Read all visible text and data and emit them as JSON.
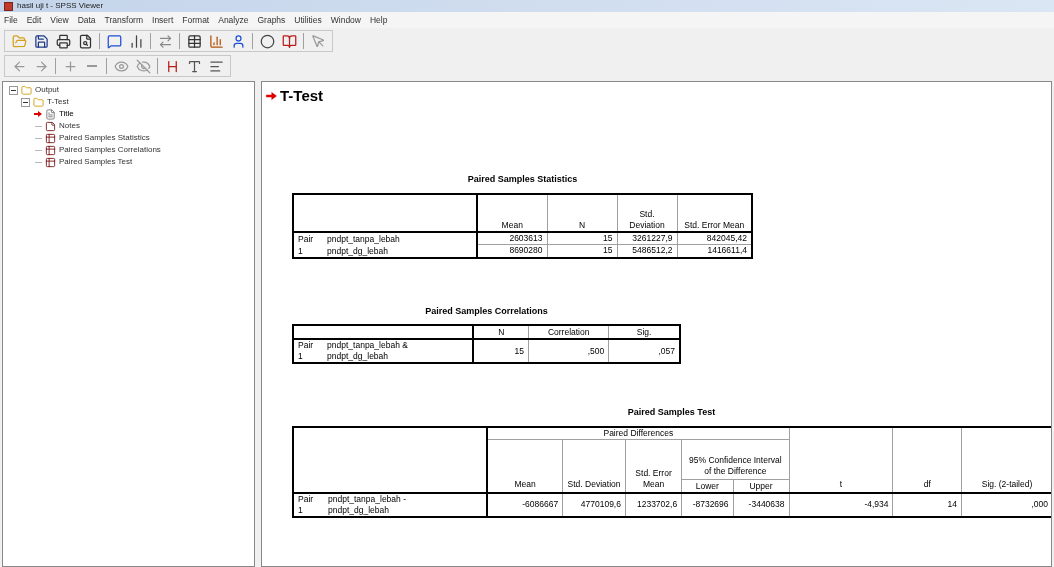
{
  "window": {
    "title": "hasil uji t - SPSS Viewer"
  },
  "menu": [
    "File",
    "Edit",
    "View",
    "Data",
    "Transform",
    "Insert",
    "Format",
    "Analyze",
    "Graphs",
    "Utilities",
    "Window",
    "Help"
  ],
  "toolbar_1": [
    {
      "kind": "open"
    },
    {
      "kind": "save"
    },
    {
      "kind": "print"
    },
    {
      "kind": "preview"
    },
    {
      "kind": "sep"
    },
    {
      "kind": "dialog"
    },
    {
      "kind": "chart"
    },
    {
      "kind": "sep"
    },
    {
      "kind": "goto"
    },
    {
      "kind": "sep"
    },
    {
      "kind": "table"
    },
    {
      "kind": "bars"
    },
    {
      "kind": "person"
    },
    {
      "kind": "sep"
    },
    {
      "kind": "circle"
    },
    {
      "kind": "book"
    },
    {
      "kind": "sep"
    },
    {
      "kind": "cursor"
    }
  ],
  "toolbar_2": [
    {
      "kind": "left"
    },
    {
      "kind": "right"
    },
    {
      "kind": "sep"
    },
    {
      "kind": "plus"
    },
    {
      "kind": "minus"
    },
    {
      "kind": "sep"
    },
    {
      "kind": "show"
    },
    {
      "kind": "hide"
    },
    {
      "kind": "sep"
    },
    {
      "kind": "heading"
    },
    {
      "kind": "title"
    },
    {
      "kind": "text"
    }
  ],
  "outline": [
    {
      "label": "Output",
      "kind": "folder",
      "expanded": true,
      "children": [
        {
          "label": "T-Test",
          "kind": "folder",
          "expanded": true,
          "children": [
            {
              "label": "Title",
              "kind": "title",
              "selected": true
            },
            {
              "label": "Notes",
              "kind": "notes",
              "selected": false
            },
            {
              "label": "Paired Samples Statistics",
              "kind": "table",
              "selected": false
            },
            {
              "label": "Paired Samples Correlations",
              "kind": "table",
              "selected": false
            },
            {
              "label": "Paired Samples Test",
              "kind": "table",
              "selected": false
            }
          ]
        }
      ]
    }
  ],
  "heading": "T-Test",
  "statistics": {
    "title": "Paired Samples Statistics",
    "columns": [
      "Mean",
      "N",
      "Std. Deviation",
      "Std. Error Mean"
    ],
    "pair": "Pair 1",
    "rows": [
      {
        "variable": "pndpt_tanpa_lebah",
        "cells": [
          "2603613",
          "15",
          "3261227,9",
          "842045,42"
        ]
      },
      {
        "variable": "pndpt_dg_lebah",
        "cells": [
          "8690280",
          "15",
          "5486512,2",
          "1416611,4"
        ]
      }
    ]
  },
  "correlations": {
    "title": "Paired Samples Correlations",
    "columns": [
      "N",
      "Correlation",
      "Sig."
    ],
    "pair": "Pair 1",
    "rows": [
      {
        "variable": "pndpt_tanpa_lebah & pndpt_dg_lebah",
        "cells": [
          "15",
          ",500",
          ",057"
        ]
      }
    ]
  },
  "test": {
    "title": "Paired Samples Test",
    "group": "Paired Differences",
    "interval": "95% Confidence Interval of the Difference",
    "columns": [
      "Mean",
      "Std. Deviation",
      "Std. Error Mean"
    ],
    "interval_columns": [
      "Lower",
      "Upper"
    ],
    "after_columns": [
      "t",
      "df",
      "Sig. (2-tailed)"
    ],
    "pair": "Pair 1",
    "rows": [
      {
        "variable": "pndpt_tanpa_lebah - pndpt_dg_lebah",
        "cells": [
          "-6086667",
          "4770109,6",
          "1233702,6",
          "-8732696",
          "-3440638",
          "-4,934",
          "14",
          ",000"
        ]
      }
    ]
  }
}
